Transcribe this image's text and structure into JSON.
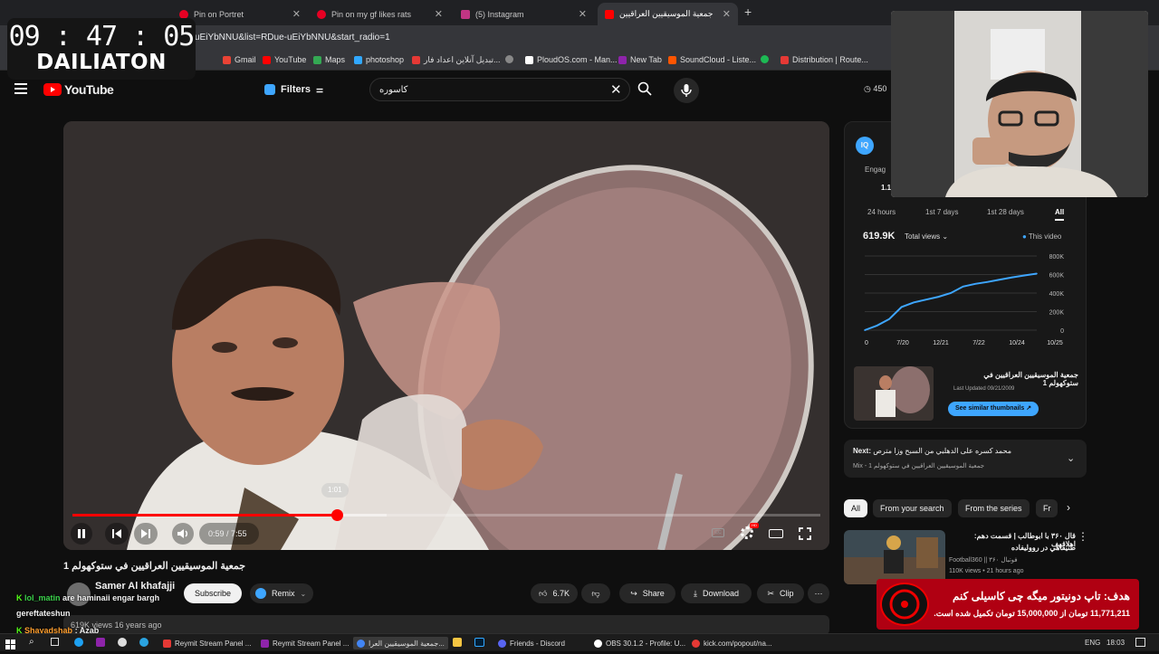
{
  "browser": {
    "tabs": [
      {
        "title": "Pin on Portret",
        "color": "#e60023"
      },
      {
        "title": "Pin on my gf likes rats",
        "color": "#e60023"
      },
      {
        "title": "(5) Instagram",
        "color": "#c13584"
      },
      {
        "title": "جمعية الموسيقيين العراقيين",
        "color": "#ff0000"
      }
    ],
    "new_tab_label": "+",
    "url": "uEiYbNNU&list=RDue-uEiYbNNU&start_radio=1",
    "bookmarks": [
      {
        "label": "Gmail",
        "color": "#ea4335"
      },
      {
        "label": "YouTube",
        "color": "#ff0000"
      },
      {
        "label": "Maps",
        "color": "#34a853"
      },
      {
        "label": "photoshop",
        "color": "#31a8ff"
      },
      {
        "label": "تبدیل آنلاین اعداد فار...",
        "color": "#e53935"
      },
      {
        "label": "",
        "color": "#888888"
      },
      {
        "label": "PloudOS.com - Man...",
        "color": "#ffffff"
      },
      {
        "label": "New Tab",
        "color": "#8e24aa"
      },
      {
        "label": "SoundCloud - Liste...",
        "color": "#ff5500"
      },
      {
        "label": "",
        "color": "#1db954"
      },
      {
        "label": "Distribution | Route...",
        "color": "#e53935"
      }
    ]
  },
  "header": {
    "logo_text": "YouTube",
    "filters_label": "Filters",
    "search_value": "کاسوره",
    "counter": "450"
  },
  "player": {
    "time_label": "0:59 / 7:55",
    "hover_time": "1:01",
    "progress_fraction": 0.354,
    "buffer_fraction": 0.42
  },
  "video": {
    "title": "جمعية الموسيقيين العراقيين في ستوكهولم 1",
    "channel": "Samer Al khafajji",
    "subscribe_label": "Subscribe",
    "remix_label": "Remix",
    "likes": "6.7K",
    "share_label": "Share",
    "download_label": "Download",
    "clip_label": "Clip",
    "views_line": "619K views  16 years ago"
  },
  "chat": [
    {
      "user": "lol_matin",
      "message": "are haminaii engar bargh",
      "color": "#3bd14b"
    },
    {
      "user": "gereftateshun",
      "message": "",
      "color": "#ffffff"
    },
    {
      "user": "Shayadshab",
      "message": "Azab",
      "color": "#ff9f2e"
    }
  ],
  "analytics": {
    "engagement_label": "Engag",
    "engagement_value": "1.1",
    "ranges": [
      "24 hours",
      "1st 7 days",
      "1st 28 days",
      "All"
    ],
    "views_total": "619.9K",
    "views_select": "Total views",
    "this_video": "This video",
    "chart_data": {
      "type": "line",
      "x_ticks": [
        "0",
        "7/20",
        "12/21",
        "7/22",
        "10/24",
        "10/25"
      ],
      "y_ticks": [
        "800K",
        "600K",
        "400K",
        "200K",
        "0"
      ],
      "ylim": [
        0,
        800000
      ],
      "values": [
        0,
        50000,
        120000,
        250000,
        300000,
        330000,
        360000,
        400000,
        470000,
        500000,
        520000,
        545000,
        570000,
        590000,
        610000
      ],
      "series_color": "#3ea6ff"
    },
    "thumb_title": "جمعية الموسيقيين العراقيين في ستوكهولم 1",
    "last_updated": "Last Updated 09/21/2009",
    "similar_label": "See similar thumbnails"
  },
  "next": {
    "label": "Next:",
    "title": "محمد كسره على الدهلبي من السبح وزا مترص",
    "sub": "Mix - جمعية الموسيقيين العراقيين في ستوكهولم 1"
  },
  "chips": [
    "All",
    "From your search",
    "From the series",
    "Fr"
  ],
  "rec": {
    "title": "قال ۳۶۰ با ابوطالب | قسمت دهم: اهلاقهف",
    "title2": "طنيقاهي در رووليفاده",
    "channel": "Football360 || فوتبال ۳۶۰",
    "meta": "110K views • 21 hours ago"
  },
  "clock": {
    "time": "09 : 47 : 05",
    "label": "DAILIATON"
  },
  "donation": {
    "title": "هدف: تاپ دونیتور میگه چی کاسیلی کنم",
    "subtitle": "11,771,211 تومان از 15,000,000 تومان تکمیل شده است."
  },
  "taskbar": {
    "apps": [
      {
        "label": "Reymit Stream Panel ...",
        "color": "#e53935"
      },
      {
        "label": "Reymit Stream Panel ...",
        "color": "#8e24aa"
      },
      {
        "label": "جمعية الموسيقيين العرا...",
        "color": "#4285f4"
      },
      {
        "label": "Friends - Discord",
        "color": "#5865f2"
      },
      {
        "label": "OBS 30.1.2 - Profile: U...",
        "color": "#ffffff"
      },
      {
        "label": "kick.com/popout/na...",
        "color": "#e53935"
      }
    ],
    "lang": "ENG",
    "time": "18:03"
  }
}
